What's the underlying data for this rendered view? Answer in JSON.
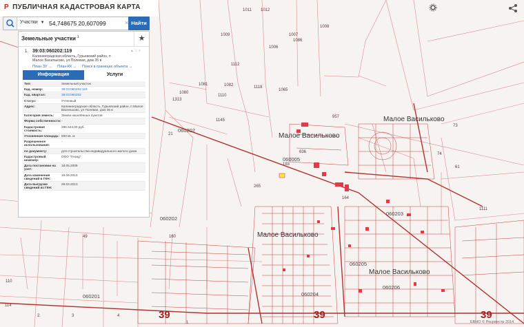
{
  "app": {
    "title": "ПУБЛИЧНАЯ КАДАСТРОВАЯ КАРТА",
    "logo": "P"
  },
  "search": {
    "type_label": "Участки",
    "query": "54,748675 20,607099",
    "find_label": "Найти",
    "clear": "×"
  },
  "panel": {
    "title": "Земельные участки",
    "count": "1",
    "star": "★",
    "result": {
      "index": "1.",
      "cad_number": "39:03:060202:119",
      "address": "Калининградская область, Гурьевский район, п Малое Васильково, ул Полевая, дом 35 в",
      "icons": "▲ ☆ ×",
      "links": [
        "План ЗУ →",
        "План КК →",
        "Поиск в границах объекта →"
      ]
    },
    "tabs": [
      "Информация",
      "Услуги"
    ],
    "info": [
      {
        "k": "Тип:",
        "v": "Земельный участок",
        "link": false
      },
      {
        "k": "Кад. номер:",
        "v": "39:03:060202:119",
        "link": true
      },
      {
        "k": "Кад. квартал:",
        "v": "39:03:060202",
        "link": true
      },
      {
        "k": "Статус:",
        "v": "Учтенный",
        "link": false
      },
      {
        "k": "Адрес:",
        "v": "Калининградская область, Гурьевский район, п Малое Васильково, ул Полевая, дом 35 в",
        "link": false
      },
      {
        "k": "Категория земель:",
        "v": "Земли населённых пунктов",
        "link": false
      },
      {
        "k": "Форма собственности:",
        "v": "-",
        "link": false
      },
      {
        "k": "Кадастровая стоимость:",
        "v": "295 644,00 руб.",
        "link": false
      },
      {
        "k": "Уточненная площадь:",
        "v": "600 кв. м",
        "link": false
      },
      {
        "k": "Разрешенное использование:",
        "v": "-",
        "link": false
      },
      {
        "k": "по документу:",
        "v": "для строительства индивидуального жилого дома",
        "link": false
      },
      {
        "k": "Кадастровый инженер:",
        "v": "ООО \"Геоид\"",
        "link": false
      },
      {
        "k": "Дата постановки на учет:",
        "v": "18.05.2009",
        "link": false
      },
      {
        "k": "Дата изменения сведений в ГКН:",
        "v": "19.09.2013",
        "link": false
      },
      {
        "k": "Дата выгрузки сведений из ГКН:",
        "v": "29.03.2013",
        "link": false
      }
    ]
  },
  "map": {
    "settlements": [
      "Малое Васильково",
      "Малое Васильково",
      "Малое Васильково",
      "Малое Васильково"
    ],
    "quarters": [
      "060202",
      "060005",
      "060202",
      "060203",
      "060205",
      "060206",
      "060201",
      "060204"
    ],
    "districts": [
      "39",
      "39",
      "39"
    ],
    "parcels": [
      "1011",
      "1012",
      "1007",
      "1008",
      "1006",
      "1009",
      "1112",
      "1110",
      "1065",
      "1080",
      "1081",
      "1082",
      "1118",
      "1145",
      "21",
      "265",
      "636",
      "957",
      "164",
      "73",
      "74",
      "61",
      "1111",
      "49",
      "110",
      "114",
      "2",
      "3",
      "4",
      "1",
      "160",
      "193",
      "1313",
      "1086"
    ],
    "colors": {
      "boundary": "#c23b3b",
      "building": "#e23a4a",
      "road": "#b03030",
      "highlight": "#ffe14a"
    }
  },
  "attribution": "ЕВНО © Росреестр 2014"
}
